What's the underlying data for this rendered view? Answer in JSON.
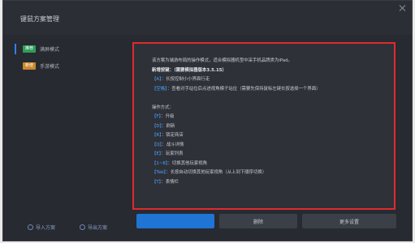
{
  "window": {
    "title": "键鼠方案管理"
  },
  "sidebar": {
    "modes": [
      {
        "tag": "推荐",
        "label": "满屏模式",
        "tag_color": "#2f9d5a",
        "active": true
      },
      {
        "tag": "新增",
        "label": "手游模式",
        "tag_color": "#c9892a",
        "active": false
      }
    ],
    "import_label": "导入方案",
    "export_label": "导出方案"
  },
  "description": {
    "lines": [
      {
        "text": "该方案为端游布局的操作模式，适合模拟器机型中采手机品牌类为iPad。",
        "style": "normal"
      },
      {
        "text": "新增按键：（需要模拟器版本3.5.15）",
        "style": "hl"
      },
      {
        "text": "【A】：长按控制小小界面行走",
        "style": "key"
      },
      {
        "text": "【空格】：查看对手站位后点进视角模子站位（需要先保持鼠标左键长按选择一个界面）",
        "style": "key"
      },
      {
        "text": "",
        "style": "normal"
      },
      {
        "text": "操作方式：",
        "style": "normal"
      },
      {
        "text": "【F】：升级",
        "style": "key"
      },
      {
        "text": "【D】：刷新",
        "style": "key"
      },
      {
        "text": "【R】：锁定商店",
        "style": "key"
      },
      {
        "text": "【Q】：战斗详情",
        "style": "key"
      },
      {
        "text": "【E】：玩家列表",
        "style": "key"
      },
      {
        "text": "【1~8】：切换其他玩家视角",
        "style": "key"
      },
      {
        "text": "【Tab】：长按自动切换其他玩家视角（从上到下顺序切换）",
        "style": "key"
      },
      {
        "text": "【T】：表情栏",
        "style": "key"
      }
    ]
  },
  "actions": {
    "primary_label": "",
    "delete_label": "删除",
    "more_label": "更多设置"
  }
}
